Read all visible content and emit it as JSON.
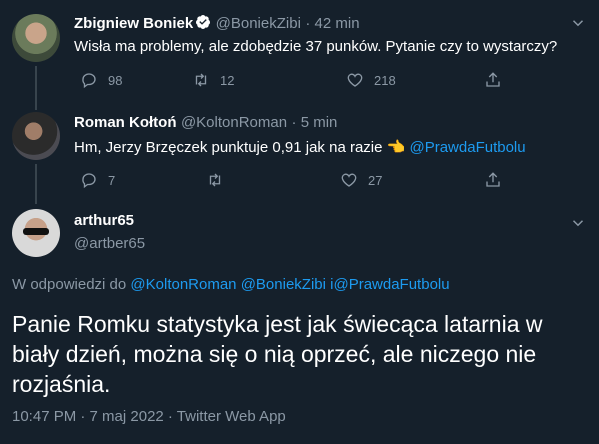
{
  "tweets": [
    {
      "name": "Zbigniew Boniek",
      "handle": "@BoniekZibi",
      "time": "· 42 min",
      "text": "Wisła ma problemy, ale zdobędzie 37 punków. Pytanie czy to wystarczy?",
      "replies": "98",
      "retweets": "12",
      "likes": "218"
    },
    {
      "name": "Roman Kołtoń",
      "handle": "@KoltonRoman",
      "time": "· 5 min",
      "text": "Hm, Jerzy Brzęczek punktuje 0,91 jak na razie 👈",
      "mention": "@PrawdaFutbolu",
      "replies": "7",
      "retweets": "",
      "likes": "27"
    }
  ],
  "main": {
    "name": "arthur65",
    "handle": "@artber65",
    "reply_prefix": "W odpowiedzi do ",
    "reply_to_1": "@KoltonRoman",
    "reply_to_2": "@BoniekZibi",
    "reply_sep": " i",
    "reply_to_3": "@PrawdaFutbolu",
    "text": "Panie Romku statystyka jest jak świecąca latarnia w biały dzień, można się o nią oprzeć, ale niczego nie rozjaśnia.",
    "meta": "10:47 PM · 7 maj 2022 · Twitter Web App"
  },
  "colors": {
    "background": "#15202b",
    "muted": "#8b98a5",
    "link": "#1d9bf0",
    "thread_line": "#38444d"
  },
  "icons": [
    "verified-icon",
    "reply-icon",
    "retweet-icon",
    "like-icon",
    "share-icon",
    "more-caret-icon"
  ]
}
